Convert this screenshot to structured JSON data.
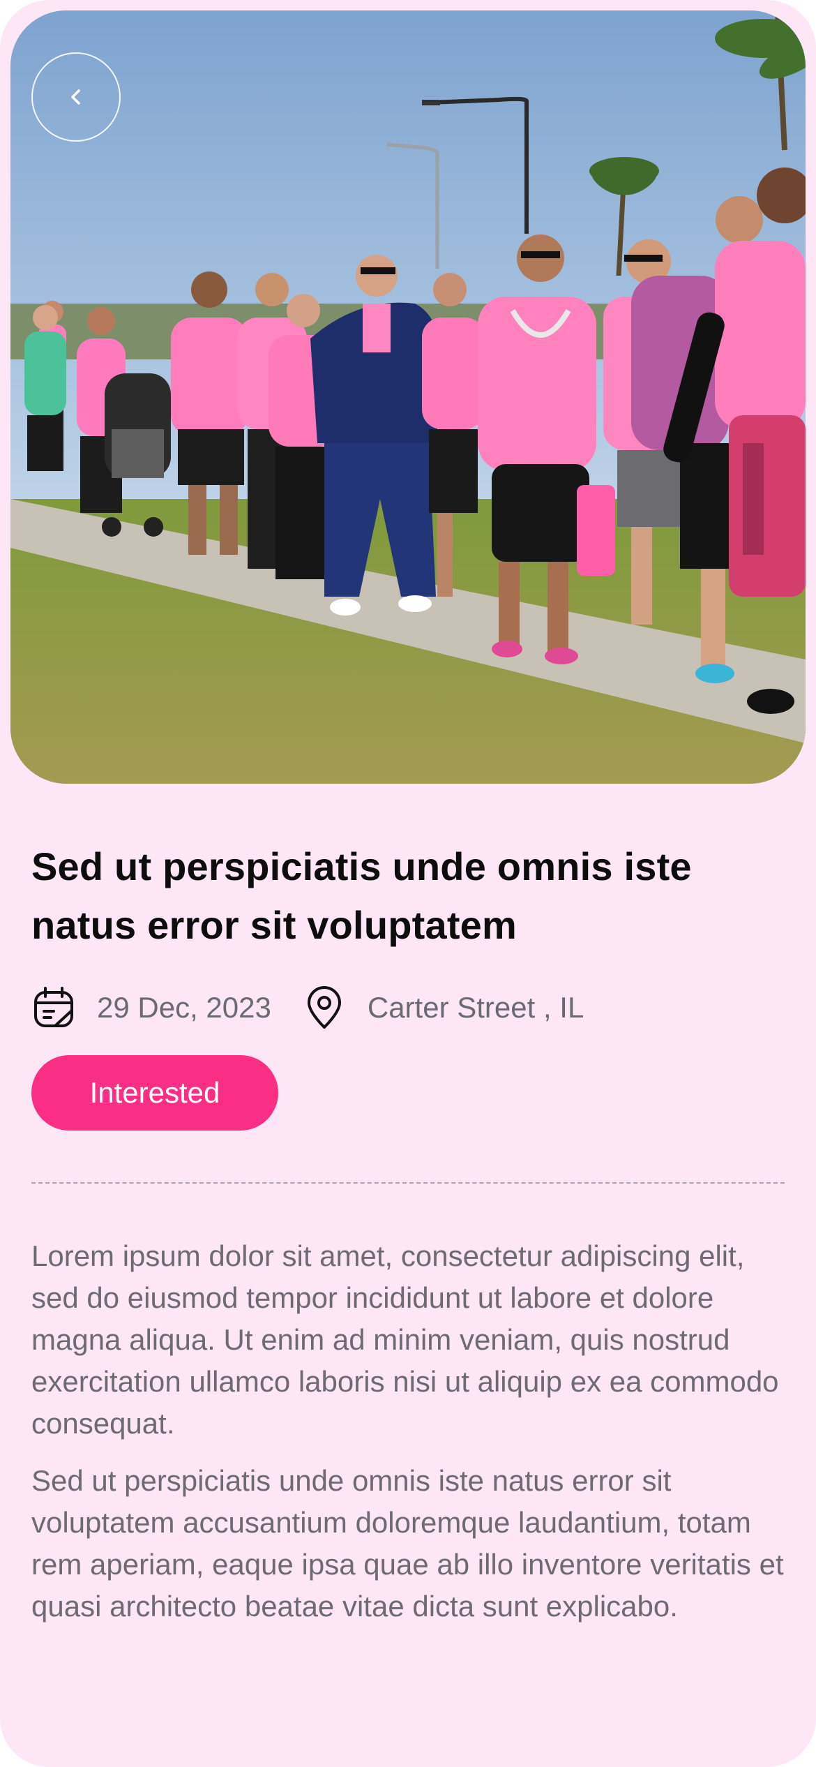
{
  "event": {
    "title": "Sed ut perspiciatis unde omnis iste natus error sit voluptatem",
    "date": "29 Dec, 2023",
    "location": "Carter Street , IL",
    "interested_label": "Interested",
    "description": [
      "Lorem ipsum dolor sit amet, consectetur adipiscing elit, sed do eiusmod tempor incididunt ut labore et dolore magna aliqua. Ut enim ad minim veniam, quis nostrud exercitation ullamco laboris nisi ut aliquip ex ea commodo consequat.",
      "Sed ut perspiciatis unde omnis iste natus error sit voluptatem accusantium doloremque laudantium, totam rem aperiam, eaque ipsa quae ab illo inventore veritatis et quasi architecto beatae vitae dicta sunt explicabo."
    ]
  },
  "icons": {
    "back": "chevron-left-icon",
    "date": "calendar-icon",
    "location": "location-pin-icon"
  },
  "colors": {
    "background": "#fde6f6",
    "accent": "#fb2e86",
    "title": "#0d0d0d",
    "body_text": "#6e6a72"
  }
}
